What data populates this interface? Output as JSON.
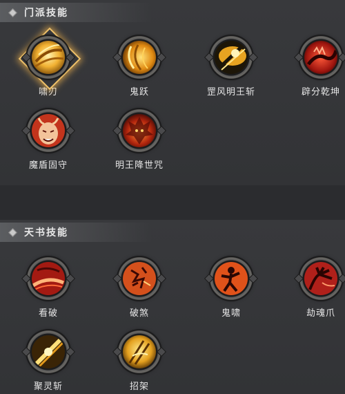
{
  "sections": [
    {
      "title": "门派技能",
      "skills": [
        {
          "label": "啸刃",
          "icon": "golden-blade-swirl-icon",
          "selected": true
        },
        {
          "label": "鬼跃",
          "icon": "golden-wind-icon",
          "selected": false
        },
        {
          "label": "罡风明王斩",
          "icon": "golden-slash-icon",
          "selected": false
        },
        {
          "label": "辟分乾坤",
          "icon": "red-dragon-icon",
          "selected": false
        },
        {
          "label": "魔盾固守",
          "icon": "demon-mask-icon",
          "selected": false
        },
        {
          "label": "明王降世咒",
          "icon": "flame-demon-icon",
          "selected": false
        }
      ]
    },
    {
      "title": "天书技能",
      "skills": [
        {
          "label": "看破",
          "icon": "red-slash-icon",
          "selected": false
        },
        {
          "label": "破煞",
          "icon": "rune-glyph-icon",
          "selected": false
        },
        {
          "label": "鬼啸",
          "icon": "shadow-warrior-icon",
          "selected": false
        },
        {
          "label": "劫魂爪",
          "icon": "red-claw-icon",
          "selected": false
        },
        {
          "label": "聚灵斩",
          "icon": "golden-strike-icon",
          "selected": false
        },
        {
          "label": "招架",
          "icon": "golden-parry-icon",
          "selected": false
        }
      ]
    }
  ],
  "colors": {
    "gold": "#f2b132",
    "red": "#c0281e",
    "selected_frame": "#f0c26a"
  }
}
